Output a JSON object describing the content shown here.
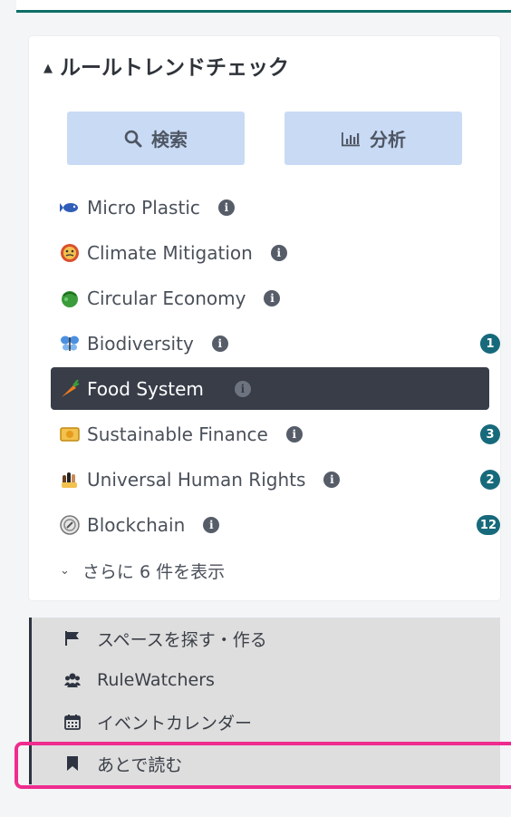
{
  "card": {
    "title": "ルールトレンドチェック",
    "search_label": "検索",
    "analysis_label": "分析"
  },
  "topics": [
    {
      "label": "Micro Plastic",
      "icon": "fish-icon",
      "badge": ""
    },
    {
      "label": "Climate Mitigation",
      "icon": "earth-face-icon",
      "badge": ""
    },
    {
      "label": "Circular Economy",
      "icon": "green-globe-icon",
      "badge": ""
    },
    {
      "label": "Biodiversity",
      "icon": "butterfly-icon",
      "badge": "1"
    },
    {
      "label": "Food System",
      "icon": "carrot-icon",
      "badge": "",
      "active": true
    },
    {
      "label": "Sustainable Finance",
      "icon": "money-icon",
      "badge": "3"
    },
    {
      "label": "Universal Human Rights",
      "icon": "hands-icon",
      "badge": "2"
    },
    {
      "label": "Blockchain",
      "icon": "chain-disc-icon",
      "badge": "12"
    }
  ],
  "more_label": "さらに 6 件を表示",
  "nav": [
    {
      "label": "スペースを探す・作る",
      "icon": "flag-icon"
    },
    {
      "label": "RuleWatchers",
      "icon": "users-icon"
    },
    {
      "label": "イベントカレンダー",
      "icon": "calendar-icon"
    },
    {
      "label": "あとで読む",
      "icon": "bookmark-icon"
    }
  ],
  "colors": {
    "accent": "#176a7b",
    "active_bg": "#383d48",
    "button_bg": "#c9daf4",
    "highlight": "#ef2c8e"
  }
}
